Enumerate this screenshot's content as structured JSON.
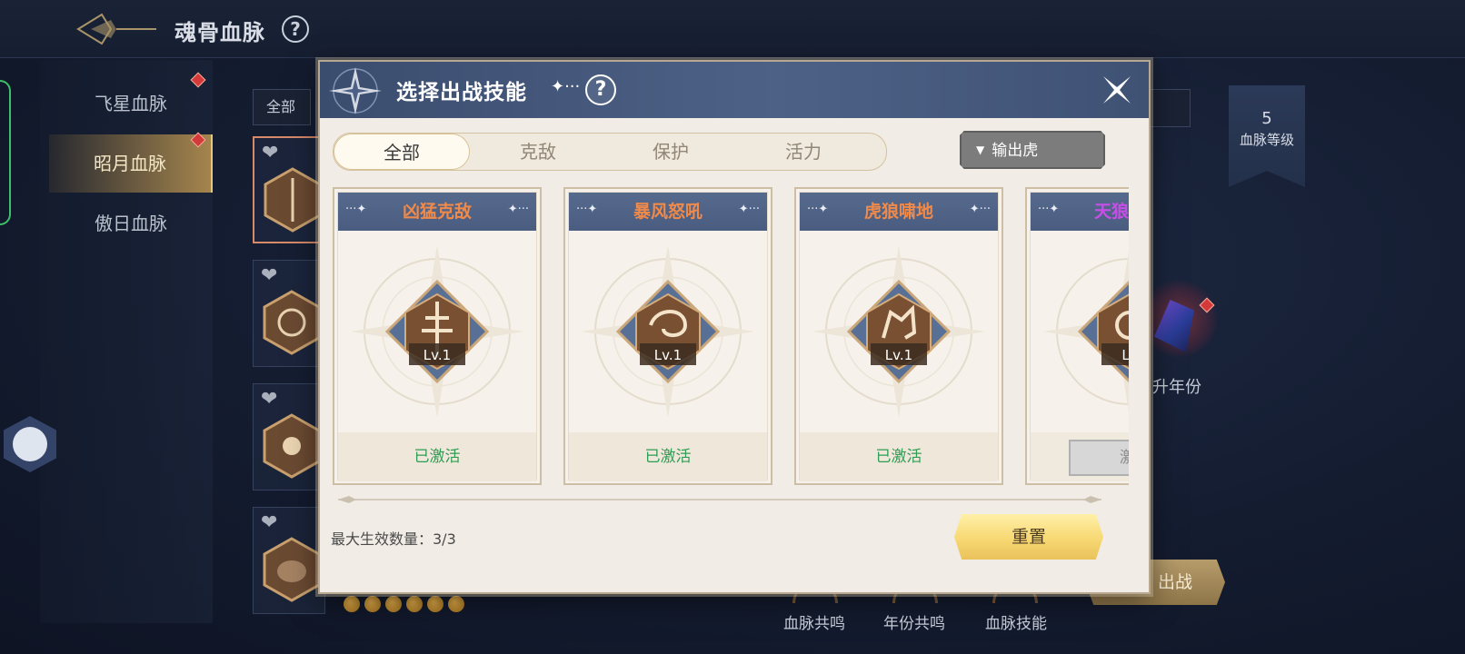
{
  "header": {
    "title": "魂骨血脉",
    "help": "?"
  },
  "sidebar": {
    "items": [
      {
        "label": "飞星血脉",
        "active": false,
        "badge": true
      },
      {
        "label": "昭月血脉",
        "active": true,
        "badge": true
      },
      {
        "label": "傲日血脉",
        "active": false,
        "badge": false
      }
    ]
  },
  "background": {
    "filter_label": "全部",
    "level_banner": {
      "value": "5",
      "label": "血脉等级"
    },
    "upgrade_year_label": "升年份",
    "battle_button": "出战",
    "bottom_tabs": [
      "血脉共鸣",
      "年份共鸣",
      "血脉技能"
    ]
  },
  "dialog": {
    "title": "选择出战技能",
    "spark": "✦···",
    "help": "?",
    "tabs": [
      {
        "label": "全部",
        "active": true
      },
      {
        "label": "克敌",
        "active": false
      },
      {
        "label": "保护",
        "active": false
      },
      {
        "label": "活力",
        "active": false
      }
    ],
    "dropdown": {
      "selected": "输出虎"
    },
    "card_deco": "···✦",
    "card_deco_right": "✦···",
    "cards": [
      {
        "name": "凶猛克敌",
        "name_color": "#f08a4a",
        "level": "Lv.1",
        "status": "已激活",
        "state": "active"
      },
      {
        "name": "暴风怒吼",
        "name_color": "#f08a4a",
        "level": "Lv.1",
        "status": "已激活",
        "state": "active"
      },
      {
        "name": "虎狼啸地",
        "name_color": "#f08a4a",
        "level": "Lv.1",
        "status": "已激活",
        "state": "active"
      },
      {
        "name": "天狼",
        "name_color": "#c94ee8",
        "level": "Lv",
        "status": "激",
        "state": "inactive"
      }
    ],
    "max_count_label": "最大生效数量：3/3",
    "reset_button": "重置"
  },
  "colors": {
    "accent_gold": "#e8c77a",
    "active_green": "#2f9c55",
    "header_blue": "#4d6187"
  }
}
